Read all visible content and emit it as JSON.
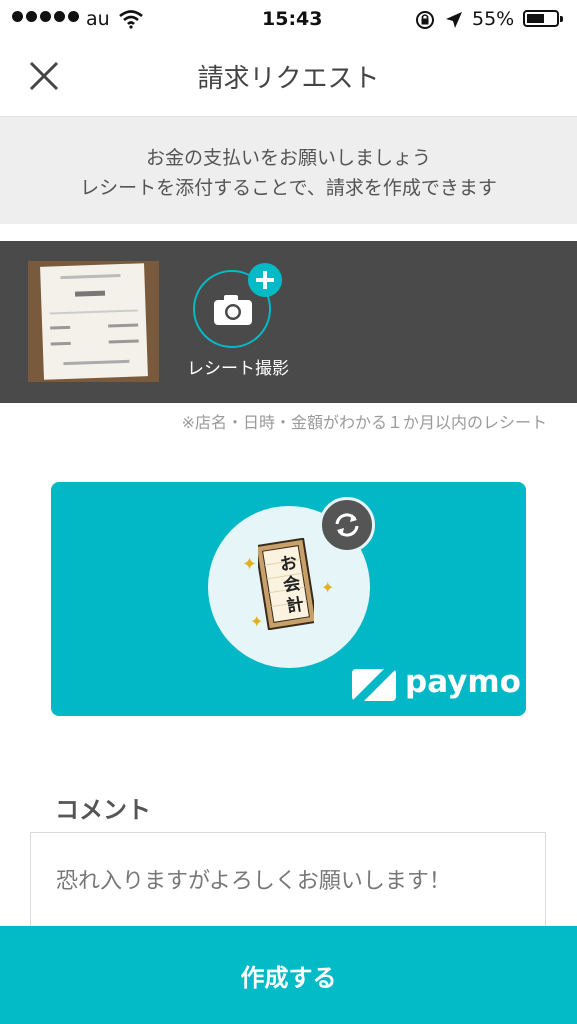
{
  "status_bar": {
    "carrier": "au",
    "time": "15:43",
    "battery": "55%"
  },
  "header": {
    "title": "請求リクエスト",
    "close_icon": "close-icon"
  },
  "info": {
    "line1": "お金の支払いをお願いしましょう",
    "line2": "レシートを添付することで、請求を作成できます"
  },
  "gallery": {
    "camera_label": "レシート撮影",
    "note": "※店名・日時・金額がわかる１か月以内のレシート"
  },
  "design_card": {
    "brand": "paymo",
    "receipt_text": "お会計"
  },
  "comment": {
    "label": "コメント",
    "value": "恐れ入りますがよろしくお願いします！"
  },
  "footer": {
    "create_label": "作成する"
  },
  "colors": {
    "accent": "#03bbc7",
    "gallery_bg": "#4a4a4a"
  }
}
